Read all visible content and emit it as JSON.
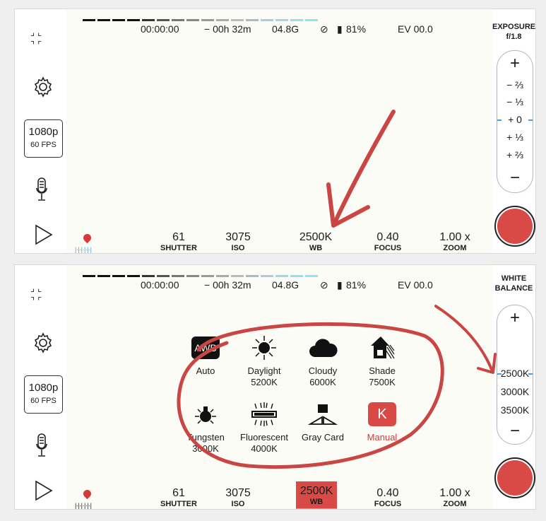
{
  "colors": {
    "accent": "#4ec6e6",
    "record": "#d94a47",
    "annotation": "#c94644",
    "manual": "#cc3b3b"
  },
  "exposure_meter_colors": [
    "#111",
    "#111",
    "#111",
    "#111",
    "#333",
    "#555",
    "#777",
    "#888",
    "#999",
    "#aaa",
    "#bbb",
    "#aab9c8",
    "#a6cde6",
    "#9cd9f0",
    "#93e0f3",
    "#8ee4f5"
  ],
  "status": {
    "timecode": "00:00:00",
    "remaining": "− 00h 32m",
    "storage": "04.8G",
    "battery": "81%",
    "ev": "EV 00.0"
  },
  "resolution": {
    "res": "1080p",
    "fps": "60 FPS"
  },
  "controls": {
    "shutter": {
      "value": "61",
      "label": "SHUTTER"
    },
    "iso": {
      "value": "3075",
      "label": "ISO"
    },
    "wb": {
      "value": "2500K",
      "label": "WB"
    },
    "focus": {
      "value": "0.40",
      "label": "FOCUS"
    },
    "zoom": {
      "value": "1.00 x",
      "label": "ZOOM"
    }
  },
  "slider_ticks": "|·|·|·|·|·|",
  "panel1": {
    "header_line1": "EXPOSURE",
    "header_line2": "f/1.8",
    "plus": "+",
    "minus": "−",
    "stops": [
      "− ⅔",
      "− ⅓",
      "+ 0",
      "+ ⅓",
      "+ ⅔"
    ]
  },
  "panel2": {
    "header_line1": "WHITE",
    "header_line2": "BALANCE",
    "plus": "+",
    "minus": "−",
    "temps": [
      "2500K",
      "3000K",
      "3500K"
    ],
    "presets": [
      {
        "name": "Auto",
        "temp": "",
        "icon": "awb-icon",
        "icon_text": "AWB"
      },
      {
        "name": "Daylight",
        "temp": "5200K",
        "icon": "sun-icon"
      },
      {
        "name": "Cloudy",
        "temp": "6000K",
        "icon": "cloud-icon"
      },
      {
        "name": "Shade",
        "temp": "7500K",
        "icon": "house-shade-icon"
      },
      {
        "name": "Tungsten",
        "temp": "3000K",
        "icon": "bulb-icon"
      },
      {
        "name": "Fluorescent",
        "temp": "4000K",
        "icon": "fluorescent-icon"
      },
      {
        "name": "Gray Card",
        "temp": "",
        "icon": "gray-card-icon"
      },
      {
        "name": "Manual",
        "temp": "",
        "icon": "kelvin-icon",
        "icon_text": "K"
      }
    ]
  }
}
